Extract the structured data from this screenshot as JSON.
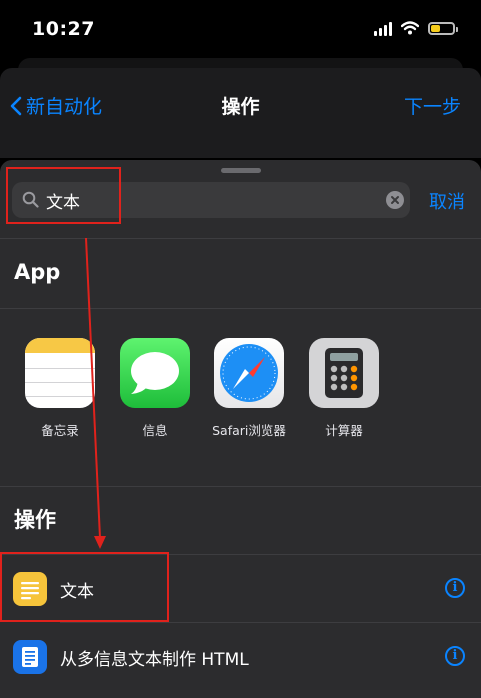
{
  "status_bar": {
    "time": "10:27"
  },
  "colors": {
    "accent": "#0a84ff",
    "annotation": "#e0221c",
    "battery": "#f5cc1c",
    "text_icon": "#f6c43b",
    "html_icon": "#1a73e8"
  },
  "nav": {
    "back_label": "新自动化",
    "title": "操作",
    "next_label": "下一步"
  },
  "search": {
    "value": "文本",
    "cancel_label": "取消"
  },
  "apps_section": {
    "title": "App",
    "apps": [
      {
        "label": "备忘录",
        "icon": "notes-app-icon"
      },
      {
        "label": "信息",
        "icon": "messages-app-icon"
      },
      {
        "label": "Safari浏览器",
        "icon": "safari-app-icon"
      },
      {
        "label": "计算器",
        "icon": "calculator-app-icon"
      }
    ]
  },
  "actions_section": {
    "title": "操作",
    "items": [
      {
        "label": "文本",
        "icon": "text-icon"
      },
      {
        "label": "从多信息文本制作 HTML",
        "icon": "html-document-icon"
      }
    ]
  },
  "info_glyph": "i"
}
